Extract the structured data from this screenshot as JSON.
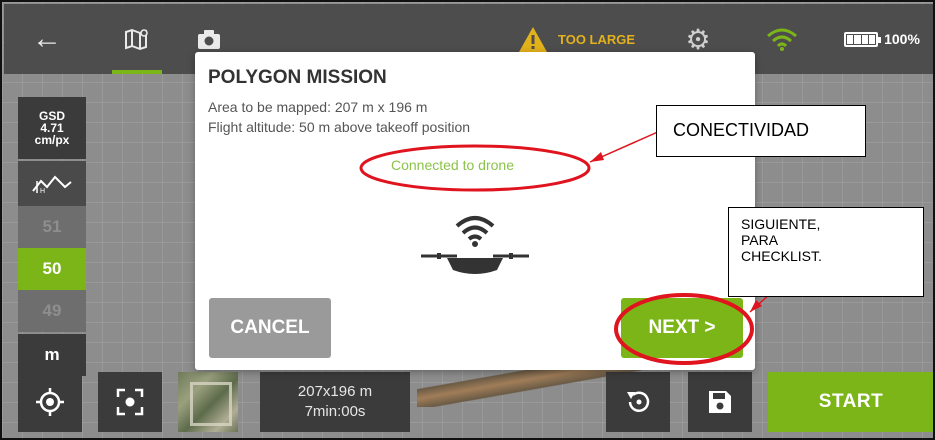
{
  "topbar": {
    "warning_text": "TOO LARGE",
    "battery_percent": "100%"
  },
  "left_panel": {
    "gsd_label": "GSD",
    "gsd_value": "4.71",
    "gsd_unit": "cm/px",
    "altitude_above": "51",
    "altitude_selected": "50",
    "altitude_below": "49",
    "unit": "m"
  },
  "bottom_bar": {
    "summary_size": "207x196 m",
    "summary_time": "7min:00s",
    "start_label": "START"
  },
  "dialog": {
    "title": "POLYGON MISSION",
    "area_text": "Area to be mapped: 207 m x 196 m",
    "altitude_text": "Flight altitude: 50 m above takeoff position",
    "connection_status": "Connected to drone",
    "cancel_label": "CANCEL",
    "next_label": "NEXT >"
  },
  "annotations": {
    "connectivity_label": "CONECTIVIDAD",
    "next_note_line1": "SIGUIENTE,",
    "next_note_line2": "PARA",
    "next_note_line3": "CHECKLIST."
  },
  "colors": {
    "accent_green": "#7cb518",
    "status_green": "#8bc34a",
    "warning_yellow": "#e3b11a",
    "annotation_red": "#e0141e",
    "panel_dark": "#3b3b3b"
  },
  "icons": {
    "back": "back-arrow-icon",
    "map": "map-icon",
    "camera": "camera-icon",
    "warning": "warning-icon",
    "settings": "gear-icon",
    "wifi": "wifi-icon",
    "battery": "battery-icon",
    "terrain": "terrain-icon",
    "locate": "locate-icon",
    "frame": "focus-frame-icon",
    "undo": "undo-icon",
    "save": "save-icon",
    "drone": "drone-icon"
  }
}
